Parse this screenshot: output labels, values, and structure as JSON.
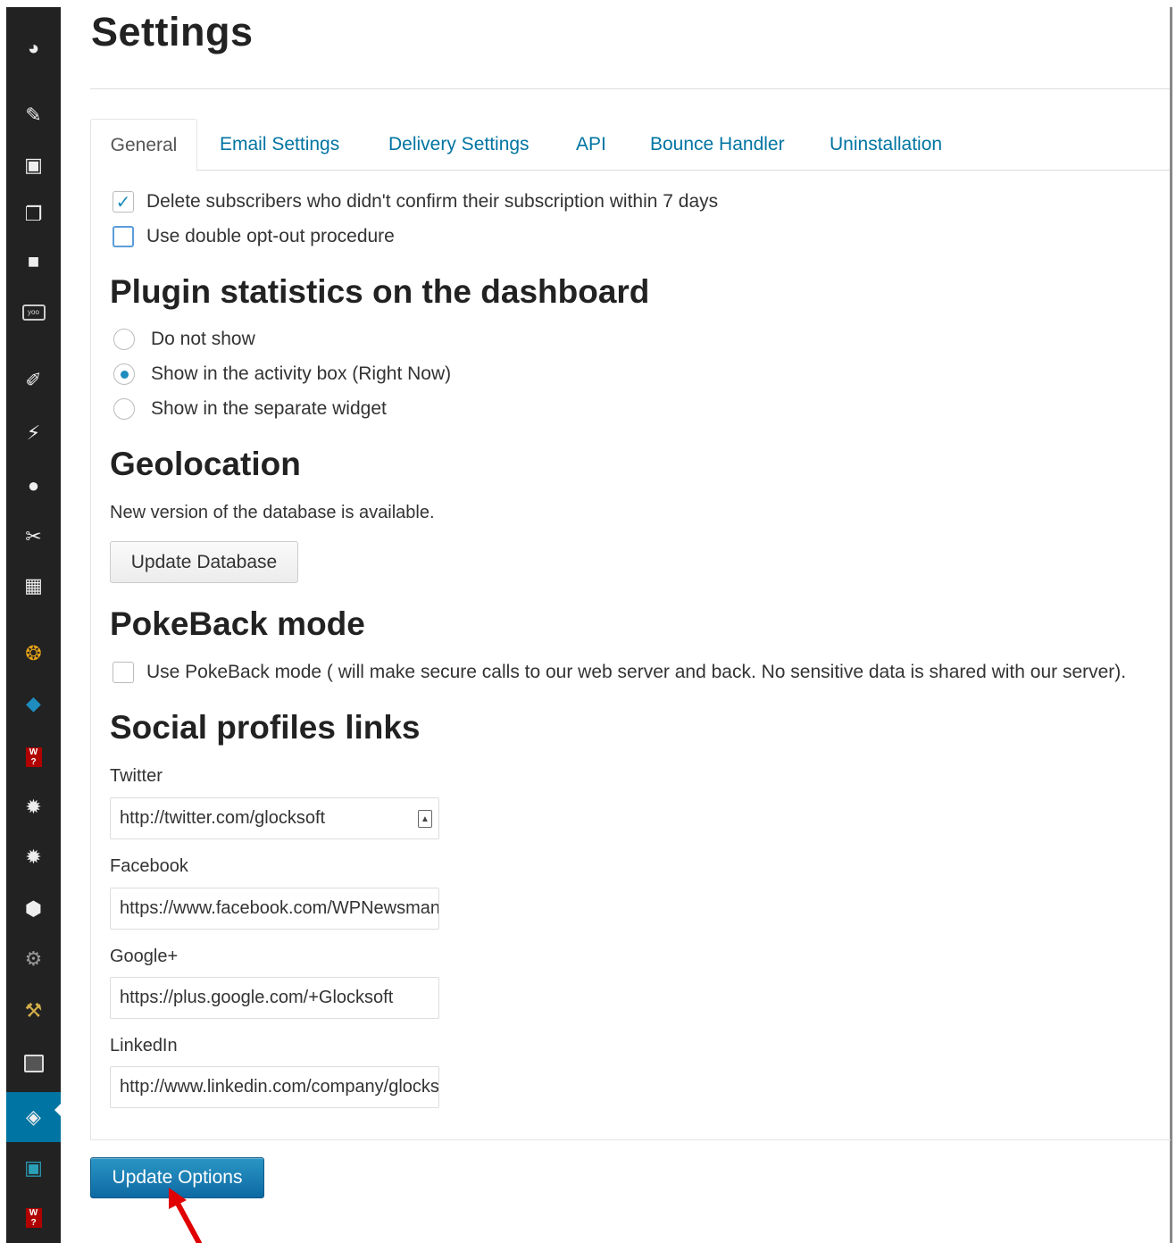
{
  "page": {
    "title": "Settings"
  },
  "sidebar": {
    "icons": [
      "dashboard-icon",
      "pin-icon",
      "media-icon",
      "pages-icon",
      "comments-icon",
      "yoo-icon",
      "appearance-icon",
      "plugins-icon",
      "users-icon",
      "tools-icon",
      "settings-icon",
      "plugin-orange-icon",
      "plugin-diamond-icon",
      "wp-badge-icon",
      "gear-icon",
      "gear-icon",
      "shield-icon",
      "network-icon",
      "hammer-icon",
      "archive-icon",
      "newsletter-icon",
      "book-icon",
      "wp-badge-icon"
    ]
  },
  "tabs": [
    {
      "label": "General",
      "active": true
    },
    {
      "label": "Email Settings",
      "active": false
    },
    {
      "label": "Delivery Settings",
      "active": false
    },
    {
      "label": "API",
      "active": false
    },
    {
      "label": "Bounce Handler",
      "active": false
    },
    {
      "label": "Uninstallation",
      "active": false
    }
  ],
  "general": {
    "delete_unconfirmed": {
      "label": "Delete subscribers who didn't confirm their subscription within 7 days",
      "checked": true
    },
    "double_optout": {
      "label": "Use double opt-out procedure",
      "checked": false
    }
  },
  "stats": {
    "heading": "Plugin statistics on the dashboard",
    "options": [
      {
        "label": "Do not show",
        "selected": false
      },
      {
        "label": "Show in the activity box (Right Now)",
        "selected": true
      },
      {
        "label": "Show in the separate widget",
        "selected": false
      }
    ]
  },
  "geo": {
    "heading": "Geolocation",
    "text": "New version of the database is available.",
    "button": "Update Database"
  },
  "pokeback": {
    "heading": "PokeBack mode",
    "label": "Use PokeBack mode ( will make secure calls to our web server and back. No sensitive data is shared with our server).",
    "checked": false
  },
  "social": {
    "heading": "Social profiles links",
    "twitter": {
      "label": "Twitter",
      "value": "http://twitter.com/glocksoft"
    },
    "facebook": {
      "label": "Facebook",
      "value": "https://www.facebook.com/WPNewsman"
    },
    "google": {
      "label": "Google+",
      "value": "https://plus.google.com/+Glocksoft"
    },
    "linkedin": {
      "label": "LinkedIn",
      "value": "http://www.linkedin.com/company/glocksoft"
    }
  },
  "footer": {
    "update_button": "Update Options"
  },
  "colors": {
    "accent": "#0074a2",
    "sidebar": "#222222",
    "primary_button": "#1e8cbe",
    "arrow": "#e00000"
  }
}
